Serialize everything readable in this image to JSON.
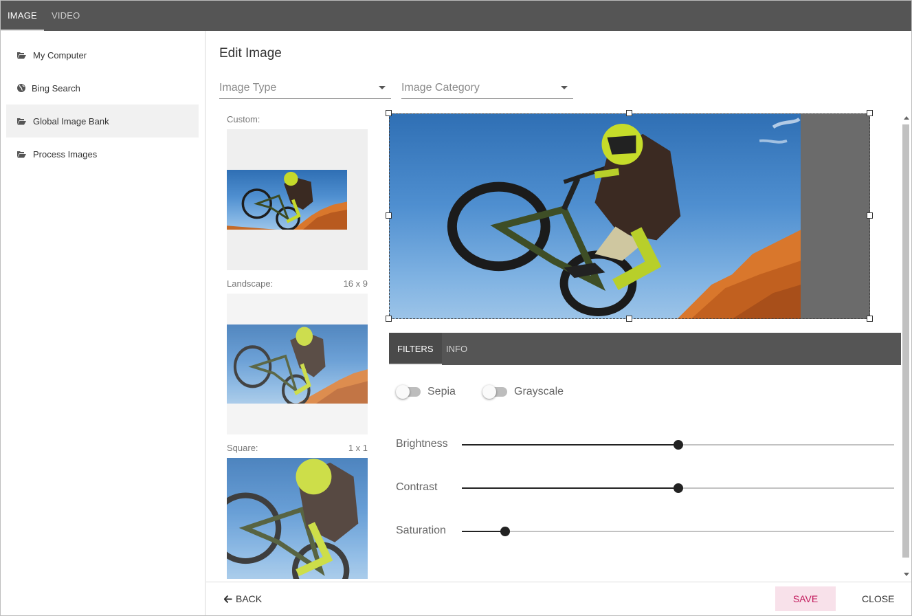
{
  "top_tabs": [
    {
      "label": "IMAGE",
      "active": true
    },
    {
      "label": "VIDEO",
      "active": false
    }
  ],
  "sidebar": {
    "items": [
      {
        "label": "My Computer",
        "icon": "folder-open-icon",
        "active": false
      },
      {
        "label": "Bing Search",
        "icon": "globe-icon",
        "active": false
      },
      {
        "label": "Global Image Bank",
        "icon": "folder-open-icon",
        "active": true
      },
      {
        "label": "Process Images",
        "icon": "folder-open-icon",
        "active": false
      }
    ]
  },
  "main": {
    "title": "Edit Image",
    "image_type": {
      "placeholder": "Image Type"
    },
    "image_category": {
      "placeholder": "Image Category"
    }
  },
  "previews": [
    {
      "label": "Custom:",
      "ratio": ""
    },
    {
      "label": "Landscape:",
      "ratio": "16 x 9"
    },
    {
      "label": "Square:",
      "ratio": "1 x 1"
    }
  ],
  "filters": {
    "tabs": [
      {
        "label": "FILTERS",
        "active": true
      },
      {
        "label": "INFO",
        "active": false
      }
    ],
    "toggles": [
      {
        "label": "Sepia",
        "on": false
      },
      {
        "label": "Grayscale",
        "on": false
      }
    ],
    "sliders": [
      {
        "label": "Brightness",
        "value": 0.5
      },
      {
        "label": "Contrast",
        "value": 0.5
      },
      {
        "label": "Saturation",
        "value": 0.1
      }
    ]
  },
  "footer": {
    "back_label": "BACK",
    "save_label": "SAVE",
    "close_label": "CLOSE"
  },
  "colors": {
    "topbar": "#555555",
    "save_accent": "#c2185b",
    "save_bg": "#f8e1ea"
  }
}
